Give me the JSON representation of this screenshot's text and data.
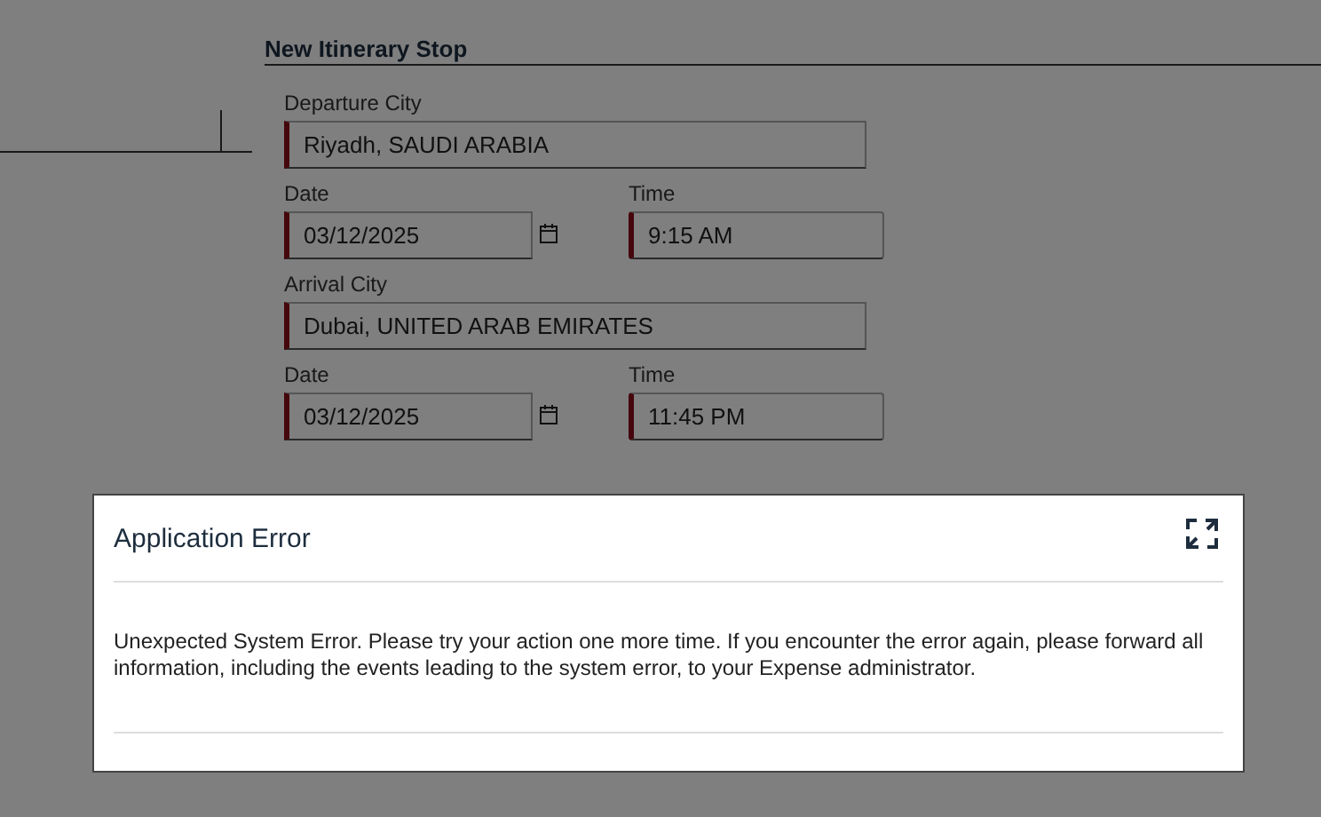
{
  "section": {
    "title": "New Itinerary Stop"
  },
  "departure": {
    "city": {
      "label": "Departure City",
      "value": "Riyadh, SAUDI ARABIA",
      "required": true
    },
    "date": {
      "label": "Date",
      "value": "03/12/2025",
      "required": true
    },
    "time": {
      "label": "Time",
      "value": "9:15 AM",
      "required": true
    }
  },
  "arrival": {
    "city": {
      "label": "Arrival City",
      "value": "Dubai, UNITED ARAB EMIRATES",
      "required": true
    },
    "date": {
      "label": "Date",
      "value": "03/12/2025",
      "required": true
    },
    "time": {
      "label": "Time",
      "value": "11:45 PM",
      "required": true
    }
  },
  "dialog": {
    "title": "Application Error",
    "message": "Unexpected System Error. Please try your action one more time. If you encounter the error again, please forward all information, including the events leading to the system error, to your Expense administrator."
  }
}
